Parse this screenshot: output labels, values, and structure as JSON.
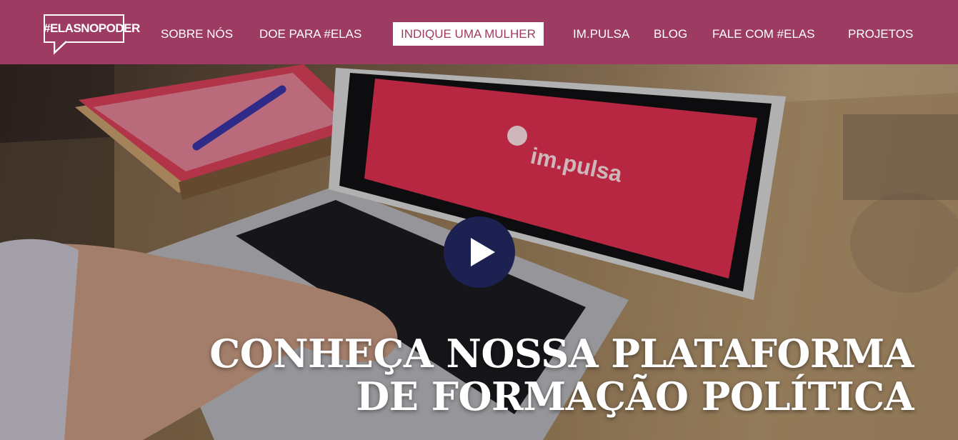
{
  "logo": {
    "text": "#ELASNOPODER"
  },
  "nav": {
    "items": [
      {
        "label": "SOBRE NÓS"
      },
      {
        "label": "DOE PARA #ELAS"
      },
      {
        "label": "INDIQUE UMA MULHER"
      },
      {
        "label": "IM.PULSA"
      },
      {
        "label": "BLOG"
      },
      {
        "label": "FALE COM #ELAS"
      },
      {
        "label": "PROJETOS"
      }
    ]
  },
  "hero": {
    "screen_text": "im.pulsa",
    "headline_line1": "CONHEÇA NOSSA PLATAFORMA",
    "headline_line2": "DE FORMAÇÃO POLÍTICA"
  },
  "colors": {
    "header_bg": "#9d3b63",
    "play_button": "#1d2152",
    "screen_red": "#e03050"
  }
}
